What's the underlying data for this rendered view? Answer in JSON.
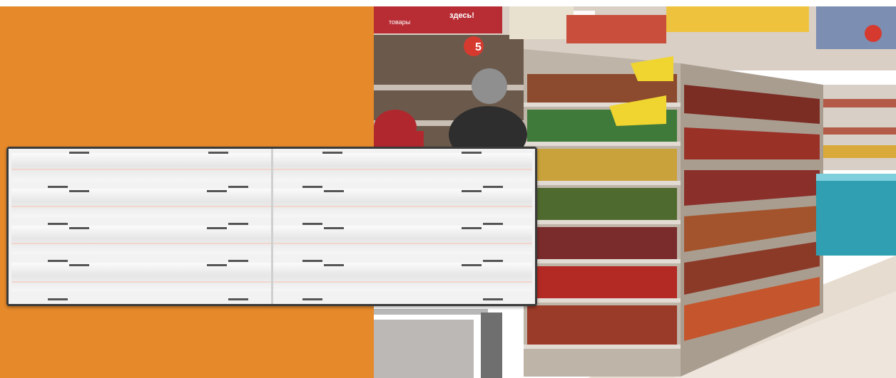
{
  "scene": {
    "left_panel_color": "#e6892a",
    "fixture_color": "#f4f4f4",
    "fixture_frame_color": "#3a3a3a"
  },
  "store": {
    "sign_main": "здесь!",
    "sign_secondary": "товары",
    "sign_number": "5"
  }
}
